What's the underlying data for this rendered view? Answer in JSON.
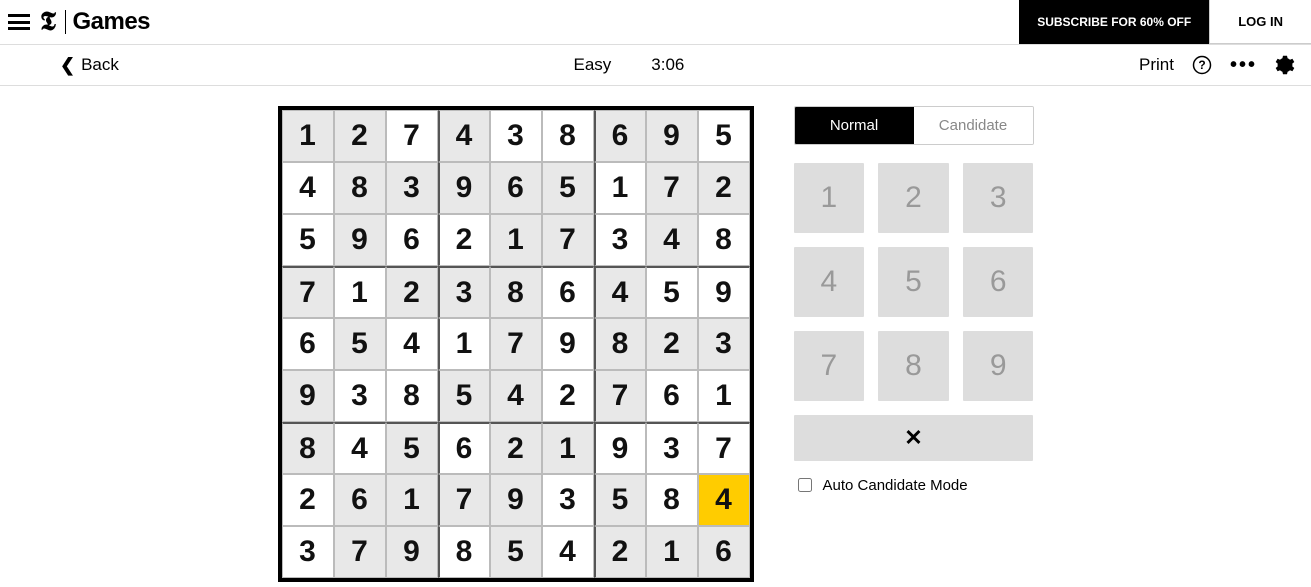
{
  "header": {
    "logo_games": "Games",
    "subscribe_label": "SUBSCRIBE FOR 60% OFF",
    "login_label": "LOG IN"
  },
  "subheader": {
    "back_label": "Back",
    "difficulty": "Easy",
    "timer": "3:06",
    "print_label": "Print"
  },
  "sudoku": {
    "grid": [
      [
        {
          "v": "1",
          "g": true
        },
        {
          "v": "2",
          "g": true
        },
        {
          "v": "7",
          "g": false
        },
        {
          "v": "4",
          "g": true
        },
        {
          "v": "3",
          "g": false
        },
        {
          "v": "8",
          "g": false
        },
        {
          "v": "6",
          "g": true
        },
        {
          "v": "9",
          "g": true
        },
        {
          "v": "5",
          "g": false
        }
      ],
      [
        {
          "v": "4",
          "g": false
        },
        {
          "v": "8",
          "g": true
        },
        {
          "v": "3",
          "g": true
        },
        {
          "v": "9",
          "g": true
        },
        {
          "v": "6",
          "g": true
        },
        {
          "v": "5",
          "g": true
        },
        {
          "v": "1",
          "g": false
        },
        {
          "v": "7",
          "g": true
        },
        {
          "v": "2",
          "g": true
        }
      ],
      [
        {
          "v": "5",
          "g": false
        },
        {
          "v": "9",
          "g": true
        },
        {
          "v": "6",
          "g": false
        },
        {
          "v": "2",
          "g": false
        },
        {
          "v": "1",
          "g": true
        },
        {
          "v": "7",
          "g": true
        },
        {
          "v": "3",
          "g": false
        },
        {
          "v": "4",
          "g": true
        },
        {
          "v": "8",
          "g": false
        }
      ],
      [
        {
          "v": "7",
          "g": true
        },
        {
          "v": "1",
          "g": false
        },
        {
          "v": "2",
          "g": true
        },
        {
          "v": "3",
          "g": true
        },
        {
          "v": "8",
          "g": true
        },
        {
          "v": "6",
          "g": false
        },
        {
          "v": "4",
          "g": true
        },
        {
          "v": "5",
          "g": false
        },
        {
          "v": "9",
          "g": false
        }
      ],
      [
        {
          "v": "6",
          "g": false
        },
        {
          "v": "5",
          "g": true
        },
        {
          "v": "4",
          "g": false
        },
        {
          "v": "1",
          "g": false
        },
        {
          "v": "7",
          "g": true
        },
        {
          "v": "9",
          "g": false
        },
        {
          "v": "8",
          "g": true
        },
        {
          "v": "2",
          "g": true
        },
        {
          "v": "3",
          "g": true
        }
      ],
      [
        {
          "v": "9",
          "g": true
        },
        {
          "v": "3",
          "g": false
        },
        {
          "v": "8",
          "g": false
        },
        {
          "v": "5",
          "g": true
        },
        {
          "v": "4",
          "g": true
        },
        {
          "v": "2",
          "g": false
        },
        {
          "v": "7",
          "g": true
        },
        {
          "v": "6",
          "g": false
        },
        {
          "v": "1",
          "g": false
        }
      ],
      [
        {
          "v": "8",
          "g": true
        },
        {
          "v": "4",
          "g": false
        },
        {
          "v": "5",
          "g": true
        },
        {
          "v": "6",
          "g": false
        },
        {
          "v": "2",
          "g": true
        },
        {
          "v": "1",
          "g": true
        },
        {
          "v": "9",
          "g": false
        },
        {
          "v": "3",
          "g": false
        },
        {
          "v": "7",
          "g": false
        }
      ],
      [
        {
          "v": "2",
          "g": false
        },
        {
          "v": "6",
          "g": true
        },
        {
          "v": "1",
          "g": true
        },
        {
          "v": "7",
          "g": true
        },
        {
          "v": "9",
          "g": true
        },
        {
          "v": "3",
          "g": false
        },
        {
          "v": "5",
          "g": true
        },
        {
          "v": "8",
          "g": false
        },
        {
          "v": "4",
          "g": false,
          "sel": true
        }
      ],
      [
        {
          "v": "3",
          "g": false
        },
        {
          "v": "7",
          "g": true
        },
        {
          "v": "9",
          "g": true
        },
        {
          "v": "8",
          "g": false
        },
        {
          "v": "5",
          "g": true
        },
        {
          "v": "4",
          "g": false
        },
        {
          "v": "2",
          "g": true
        },
        {
          "v": "1",
          "g": true
        },
        {
          "v": "6",
          "g": true
        }
      ]
    ]
  },
  "controls": {
    "mode_normal": "Normal",
    "mode_candidate": "Candidate",
    "keys": [
      "1",
      "2",
      "3",
      "4",
      "5",
      "6",
      "7",
      "8",
      "9"
    ],
    "clear_symbol": "✕",
    "auto_label": "Auto Candidate Mode"
  }
}
